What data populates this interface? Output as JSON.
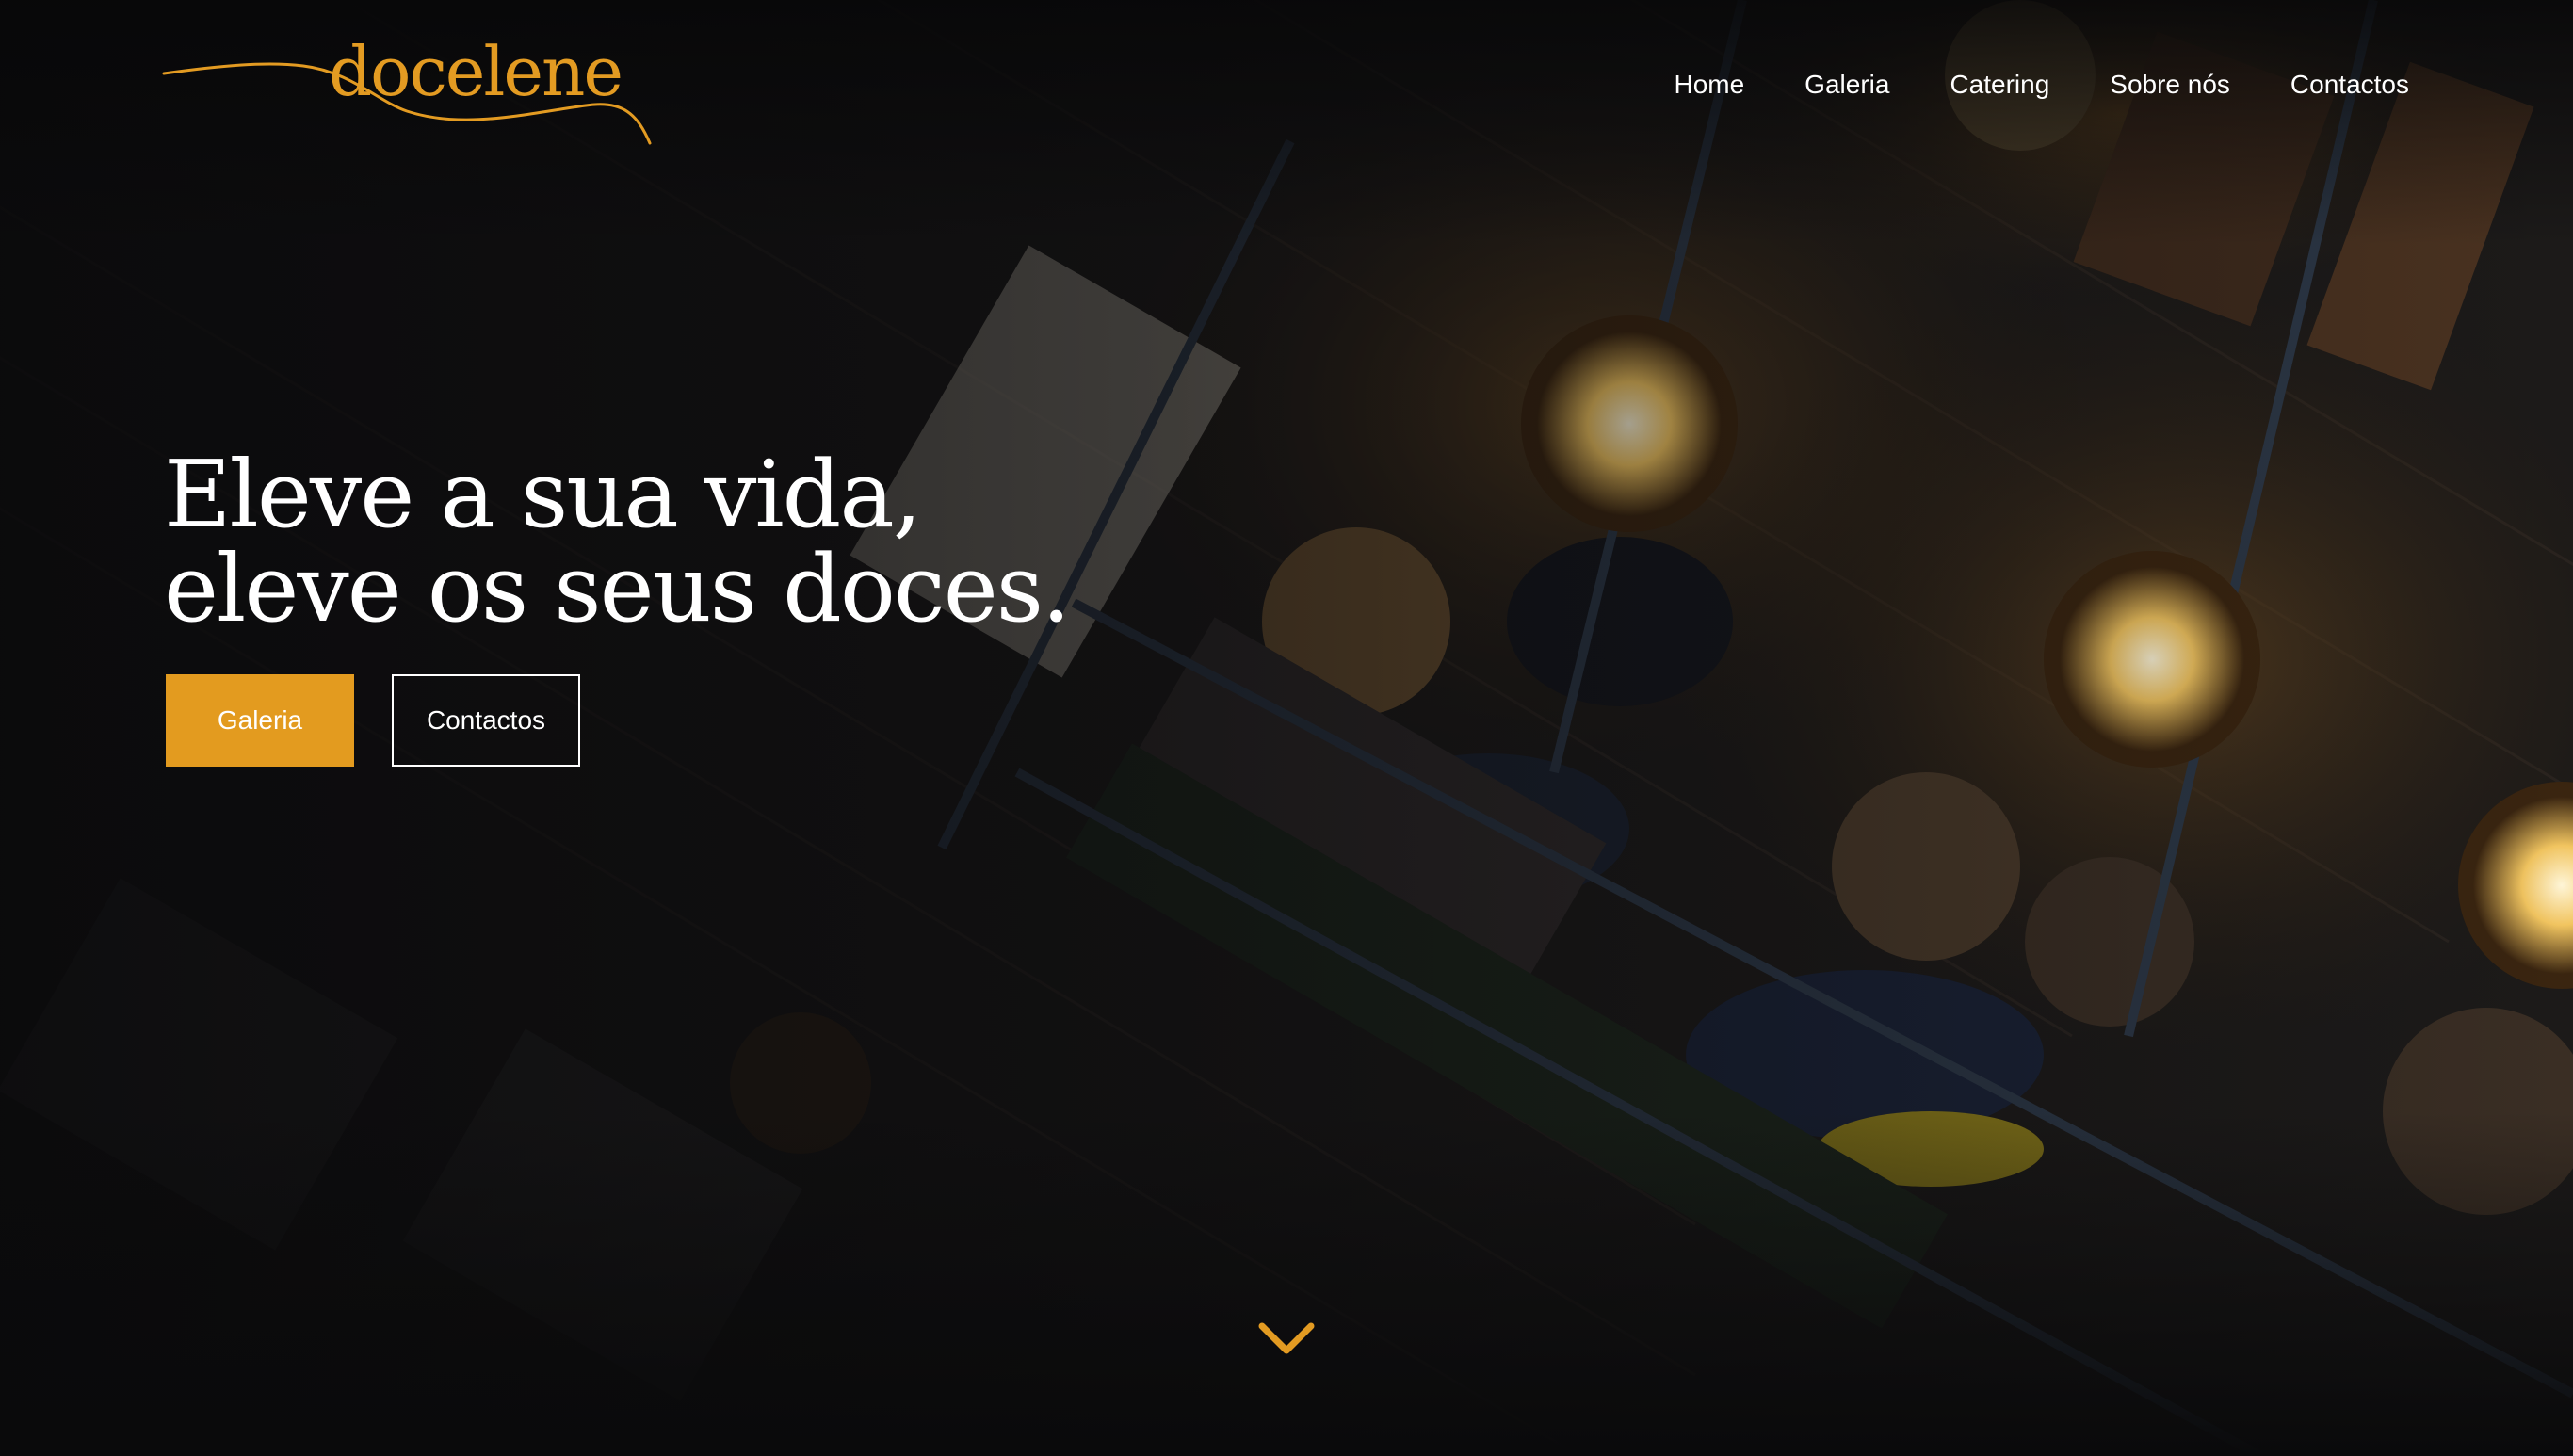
{
  "brand": {
    "name": "docelene",
    "accent_color": "#e39b22"
  },
  "nav": {
    "items": [
      {
        "label": "Home"
      },
      {
        "label": "Galeria"
      },
      {
        "label": "Catering"
      },
      {
        "label": "Sobre nós"
      },
      {
        "label": "Contactos"
      }
    ]
  },
  "hero": {
    "title_line1": "Eleve a sua vida,",
    "title_line2": "eleve os seus doces.",
    "primary_button": "Galeria",
    "secondary_button": "Contactos",
    "primary_color": "#e39b1f"
  },
  "scroll_icon": "chevron-down-icon"
}
